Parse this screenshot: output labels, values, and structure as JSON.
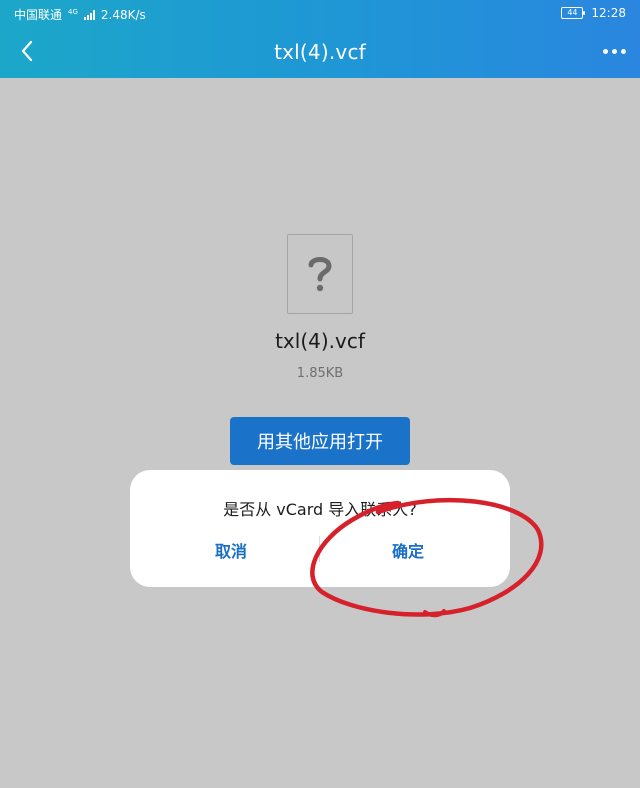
{
  "status_bar": {
    "carrier": "中国联通",
    "network_type": "4G",
    "speed": "2.48K/s",
    "battery": "44",
    "time": "12:28"
  },
  "header": {
    "title": "txl(4).vcf",
    "back_icon": "chevron-left-icon",
    "more_icon": "more-dots-icon"
  },
  "file": {
    "icon": "unknown-file-icon",
    "name": "txl(4).vcf",
    "size": "1.85KB"
  },
  "open_button_label": "用其他应用打开",
  "dialog": {
    "message": "是否从 vCard 导入联系人?",
    "cancel_label": "取消",
    "confirm_label": "确定"
  },
  "colors": {
    "header_gradient_start": "#1ca7c9",
    "header_gradient_end": "#2a86df",
    "primary_button": "#1a73c9",
    "dialog_action": "#1a6ec6",
    "annotation": "#d6202a"
  }
}
